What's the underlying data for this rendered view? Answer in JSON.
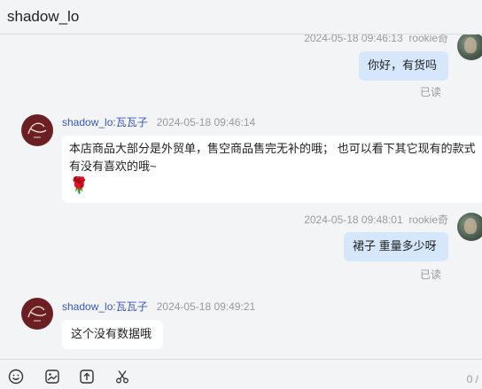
{
  "header": {
    "title": "shadow_lo"
  },
  "messages": [
    {
      "time": "2024-05-18 09:46:13",
      "sender": "rookie奇",
      "text": "你好，有货吗",
      "status": "已读"
    },
    {
      "sender": "shadow_lo:瓦瓦子",
      "time": "2024-05-18 09:46:14",
      "text": "本店商品大部分是外贸单，售空商品售完无补的哦；  也可以看下其它现有的款式有没有喜欢的哦~",
      "emoji": "🌹"
    },
    {
      "time": "2024-05-18 09:48:01",
      "sender": "rookie奇",
      "text": "裙子 重量多少呀",
      "status": "已读"
    },
    {
      "sender": "shadow_lo:瓦瓦子",
      "time": "2024-05-18 09:49:21",
      "text": "这个没有数据哦"
    }
  ],
  "toolbar": {
    "icons": [
      "emoji-icon",
      "image-icon",
      "upload-icon",
      "scissors-icon"
    ],
    "counter": "0 /"
  },
  "colors": {
    "my_bubble": "#d6e7fb",
    "their_bubble": "#ffffff",
    "name": "#3d57b3"
  }
}
